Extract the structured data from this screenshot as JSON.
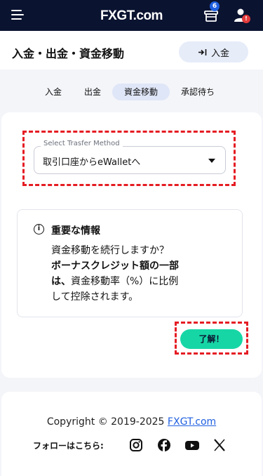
{
  "navbar": {
    "brand": "FXGT.com",
    "gift_badge": "6",
    "user_badge": "!"
  },
  "header": {
    "title": "入金・出金・資金移動",
    "deposit_button": "入金"
  },
  "tabs": [
    {
      "label": "入金",
      "active": false
    },
    {
      "label": "出金",
      "active": false
    },
    {
      "label": "資金移動",
      "active": true
    },
    {
      "label": "承認待ち",
      "active": false
    }
  ],
  "transfer": {
    "legend": "Select Trasfer Method",
    "selected": "取引口座からeWalletへ"
  },
  "notice": {
    "title": "重要な情報",
    "line1": "資金移動を続行しますか？",
    "line2_bold": "ボーナスクレジット額の一部",
    "line3_bold": "は、",
    "line3_rest": "資金移動率（%）に比例",
    "line4": "して控除されます。",
    "ok_button": "了解！"
  },
  "footer": {
    "copyright": "Copyright © 2019-2025 ",
    "link": "FXGT.com",
    "follow": "フォローはこちら:",
    "socials": [
      "instagram-icon",
      "facebook-icon",
      "youtube-icon",
      "x-icon"
    ]
  },
  "colors": {
    "navbar": "#0a1330",
    "accent": "#17d6a6",
    "link": "#1f5fe0",
    "highlight": "#e51c23"
  }
}
